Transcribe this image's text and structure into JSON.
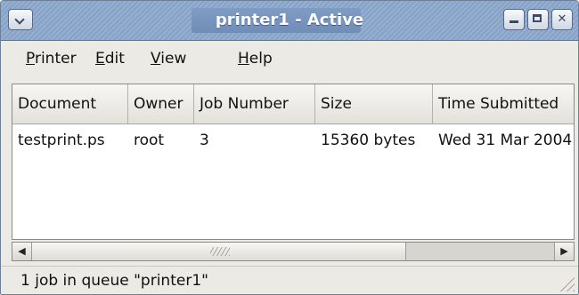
{
  "window": {
    "title": "printer1 - Active"
  },
  "menubar": {
    "items": [
      {
        "label": "Printer"
      },
      {
        "label": "Edit"
      },
      {
        "label": "View"
      },
      {
        "label": "Help"
      }
    ]
  },
  "joblist": {
    "columns": [
      "Document",
      "Owner",
      "Job Number",
      "Size",
      "Time Submitted"
    ],
    "rows": [
      {
        "document": "testprint.ps",
        "owner": "root",
        "job_number": "3",
        "size": "15360 bytes",
        "time_submitted": "Wed 31 Mar 2004"
      }
    ]
  },
  "statusbar": {
    "text": "1 job in queue \"printer1\""
  },
  "icons": [
    "window-menu-icon",
    "minimize-icon",
    "maximize-icon",
    "close-icon",
    "scroll-left-icon",
    "scroll-right-icon",
    "resize-grip-icon"
  ],
  "colors": {
    "titlebar": "#86a2c6",
    "chrome": "#eceae5",
    "list_background": "#ffffff"
  }
}
